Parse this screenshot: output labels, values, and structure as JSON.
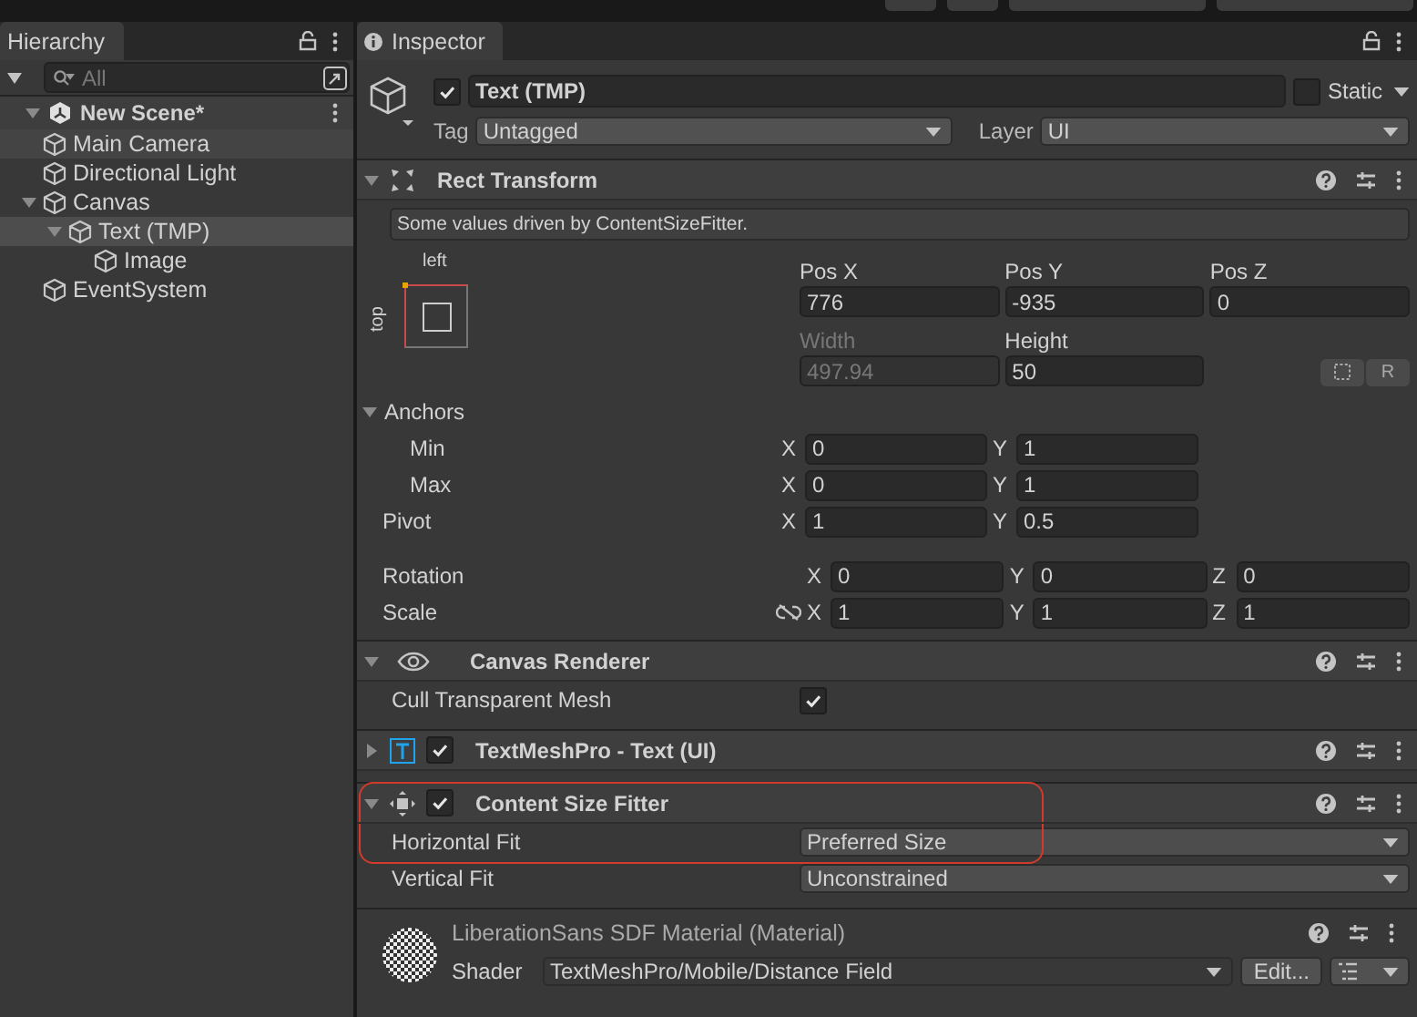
{
  "toolbar": {
    "buttons": [
      {
        "kind": "icon"
      },
      {
        "kind": "icon"
      },
      {
        "kind": "dropdown"
      },
      {
        "kind": "dropdown"
      }
    ]
  },
  "hierarchy": {
    "title": "Hierarchy",
    "search_placeholder": "All",
    "scene": {
      "name": "New Scene*",
      "expanded": true,
      "children": [
        {
          "name": "Main Camera",
          "selected": false,
          "hovered": true
        },
        {
          "name": "Directional Light",
          "selected": false,
          "hovered": false
        },
        {
          "name": "Canvas",
          "selected": false,
          "hovered": false,
          "expanded": true,
          "children": [
            {
              "name": "Text (TMP)",
              "selected": true,
              "hovered": false,
              "expanded": true,
              "children": [
                {
                  "name": "Image",
                  "selected": false,
                  "hovered": false
                }
              ]
            }
          ]
        },
        {
          "name": "EventSystem",
          "selected": false,
          "hovered": false
        }
      ]
    }
  },
  "inspector": {
    "title": "Inspector",
    "object": {
      "active": true,
      "name": "Text (TMP)",
      "static": false,
      "static_label": "Static",
      "tag_label": "Tag",
      "tag": "Untagged",
      "layer_label": "Layer",
      "layer": "UI"
    },
    "components": [
      {
        "kind": "rect_transform",
        "title": "Rect Transform",
        "expanded": true,
        "notice": "Some values driven by ContentSizeFitter.",
        "anchor_h": "left",
        "anchor_v": "top",
        "fields": [
          {
            "label": "Pos X",
            "value": "776",
            "disabled": false
          },
          {
            "label": "Pos Y",
            "value": "-935",
            "disabled": false
          },
          {
            "label": "Pos Z",
            "value": "0",
            "disabled": false
          },
          {
            "label": "Width",
            "value": "497.94",
            "disabled": true
          },
          {
            "label": "Height",
            "value": "50",
            "disabled": false
          }
        ],
        "raw_button": "R",
        "anchors": {
          "label": "Anchors",
          "expanded": true,
          "rows": [
            {
              "label": "Min",
              "axes": [
                {
                  "axis": "X",
                  "value": "0"
                },
                {
                  "axis": "Y",
                  "value": "1"
                }
              ]
            },
            {
              "label": "Max",
              "axes": [
                {
                  "axis": "X",
                  "value": "0"
                },
                {
                  "axis": "Y",
                  "value": "1"
                }
              ]
            }
          ]
        },
        "pivot": {
          "label": "Pivot",
          "axes": [
            {
              "axis": "X",
              "value": "1"
            },
            {
              "axis": "Y",
              "value": "0.5"
            }
          ]
        },
        "rotation": {
          "label": "Rotation",
          "axes": [
            {
              "axis": "X",
              "value": "0"
            },
            {
              "axis": "Y",
              "value": "0"
            },
            {
              "axis": "Z",
              "value": "0"
            }
          ]
        },
        "scale": {
          "label": "Scale",
          "constrained": false,
          "axes": [
            {
              "axis": "X",
              "value": "1"
            },
            {
              "axis": "Y",
              "value": "1"
            },
            {
              "axis": "Z",
              "value": "1"
            }
          ]
        }
      },
      {
        "kind": "canvas_renderer",
        "title": "Canvas Renderer",
        "expanded": true,
        "outlined": false,
        "properties": [
          {
            "kind": "checkbox",
            "label": "Cull Transparent Mesh",
            "checked": true,
            "outlined": false
          }
        ]
      },
      {
        "kind": "tmp_text",
        "title": "TextMeshPro - Text (UI)",
        "expanded": false,
        "enabled": true,
        "outlined": false
      },
      {
        "kind": "content_size_fitter",
        "title": "Content Size Fitter",
        "expanded": true,
        "enabled": true,
        "outlined": true,
        "properties": [
          {
            "kind": "dropdown",
            "label": "Horizontal Fit",
            "value": "Preferred Size",
            "outlined": true
          },
          {
            "kind": "dropdown",
            "label": "Vertical Fit",
            "value": "Unconstrained",
            "outlined": false
          }
        ]
      },
      {
        "kind": "material",
        "title": "LiberationSans SDF Material (Material)",
        "shader_label": "Shader",
        "shader": "TextMeshPro/Mobile/Distance Field",
        "edit_button": "Edit..."
      }
    ]
  }
}
